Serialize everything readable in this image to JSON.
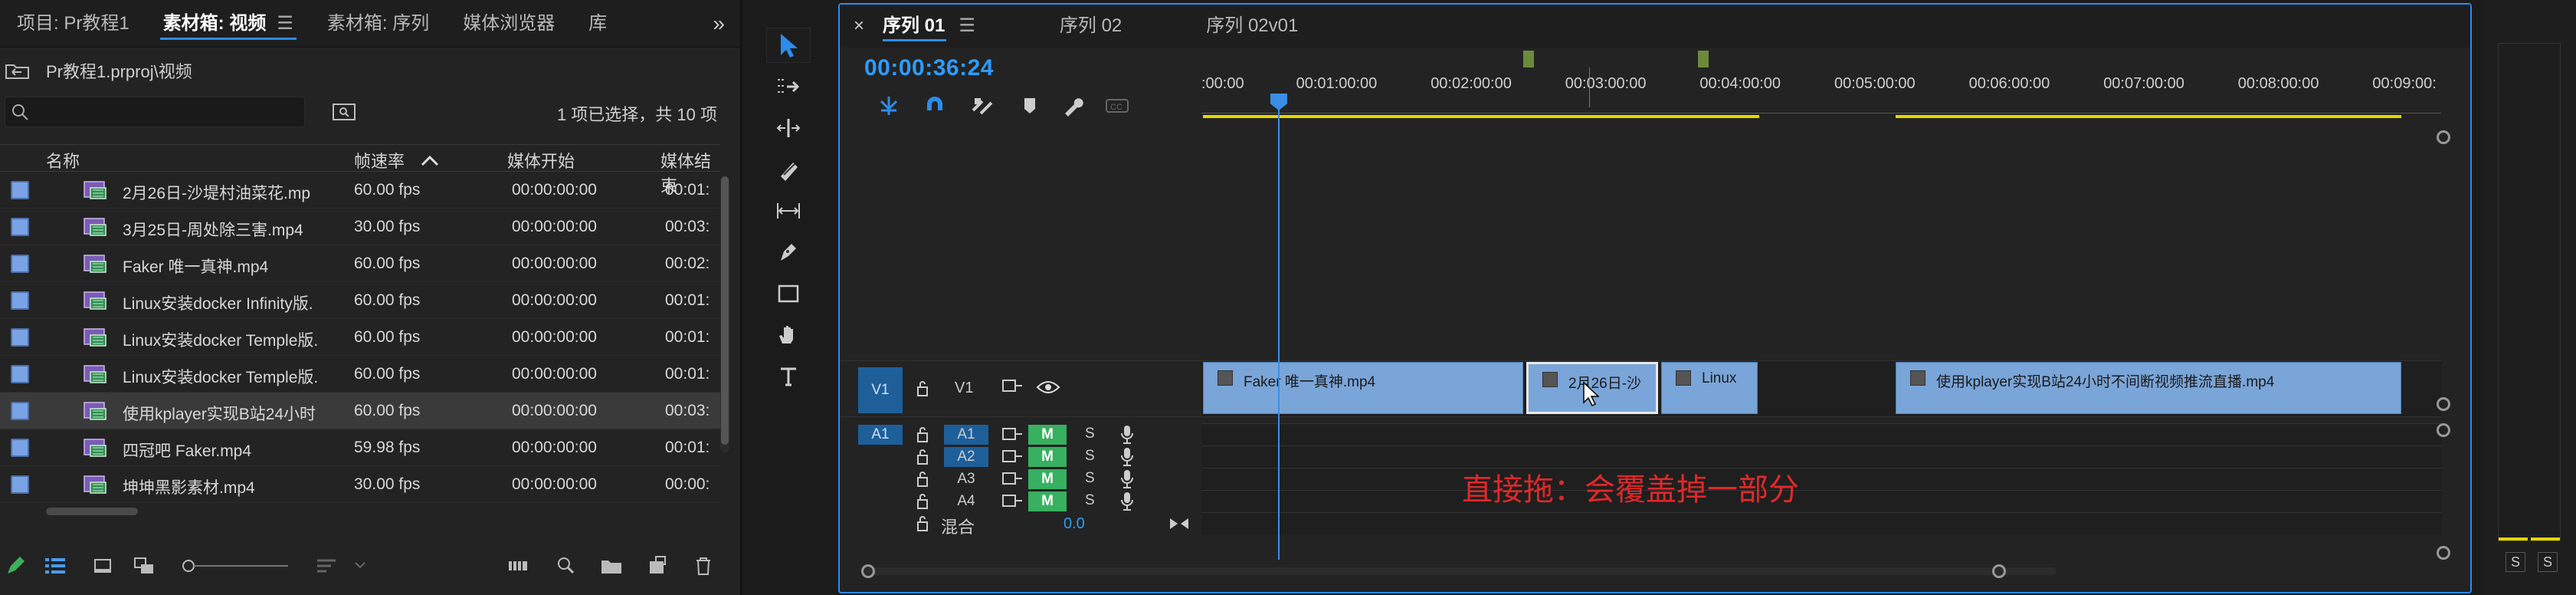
{
  "project_panel": {
    "tabs": [
      {
        "label": "项目: Pr教程1"
      },
      {
        "label": "素材箱: 视频",
        "active": true,
        "menu": "☰"
      },
      {
        "label": "素材箱: 序列"
      },
      {
        "label": "媒体浏览器"
      },
      {
        "label": "库"
      }
    ],
    "overflow": "»",
    "path": "Pr教程1.prproj\\视频",
    "selected_count": "1 项已选择，共 10 项",
    "columns": {
      "name": "名称",
      "fps": "帧速率",
      "media_start": "媒体开始",
      "media_end": "媒体结束"
    },
    "rows": [
      {
        "name": "2月26日-沙堤村油菜花.mp",
        "fps": "60.00 fps",
        "start": "00:00:00:00",
        "end": "00:01:"
      },
      {
        "name": "3月25日-周处除三害.mp4",
        "fps": "30.00 fps",
        "start": "00:00:00:00",
        "end": "00:03:"
      },
      {
        "name": "Faker 唯一真神.mp4",
        "fps": "60.00 fps",
        "start": "00:00:00:00",
        "end": "00:02:"
      },
      {
        "name": "Linux安装docker Infinity版.",
        "fps": "60.00 fps",
        "start": "00:00:00:00",
        "end": "00:01:"
      },
      {
        "name": "Linux安装docker Temple版.",
        "fps": "60.00 fps",
        "start": "00:00:00:00",
        "end": "00:01:"
      },
      {
        "name": "Linux安装docker Temple版.",
        "fps": "60.00 fps",
        "start": "00:00:00:00",
        "end": "00:01:"
      },
      {
        "name": "使用kplayer实现B站24小时",
        "fps": "60.00 fps",
        "start": "00:00:00:00",
        "end": "00:03:",
        "selected": true
      },
      {
        "name": "四冠吧 Faker.mp4",
        "fps": "59.98 fps",
        "start": "00:00:00:00",
        "end": "00:01:"
      },
      {
        "name": "坤坤黑影素材.mp4",
        "fps": "30.00 fps",
        "start": "00:00:00:00",
        "end": "00:00:"
      }
    ]
  },
  "timeline": {
    "tabs": [
      {
        "label": "序列 01",
        "active": true,
        "menu": "☰"
      },
      {
        "label": "序列 02"
      },
      {
        "label": "序列 02v01"
      }
    ],
    "close": "×",
    "timecode": "00:00:36:24",
    "ruler": [
      ":00:00",
      "00:01:00:00",
      "00:02:00:00",
      "00:03:00:00",
      "00:04:00:00",
      "00:05:00:00",
      "00:06:00:00",
      "00:07:00:00",
      "00:08:00:00",
      "00:09:00:"
    ],
    "tracks": {
      "v1_target": "V1",
      "v1_label": "V1",
      "audio": [
        {
          "target": "A1",
          "label": "A1",
          "m": "M",
          "s": "S"
        },
        {
          "target": "",
          "label": "A2",
          "m": "M",
          "s": "S"
        },
        {
          "target": "",
          "label": "A3",
          "m": "M",
          "s": "S"
        },
        {
          "target": "",
          "label": "A4",
          "m": "M",
          "s": "S"
        }
      ],
      "mix_label": "混合",
      "mix_value": "0.0"
    },
    "clips": [
      {
        "label": "Faker 唯一真神.mp4"
      },
      {
        "label": "2月26日-沙"
      },
      {
        "label": "Linux"
      },
      {
        "label": "使用kplayer实现B站24小时不间断视频推流直播.mp4"
      }
    ],
    "overlay_text": "直接拖：会覆盖掉一部分"
  },
  "meter": {
    "s_left": "S",
    "s_right": "S"
  },
  "colors": {
    "accent": "#2d8ceb",
    "clip": "#7aa5d8",
    "mute_green": "#37b060",
    "annotation": "#e0282a",
    "work_area": "#e5d600"
  }
}
